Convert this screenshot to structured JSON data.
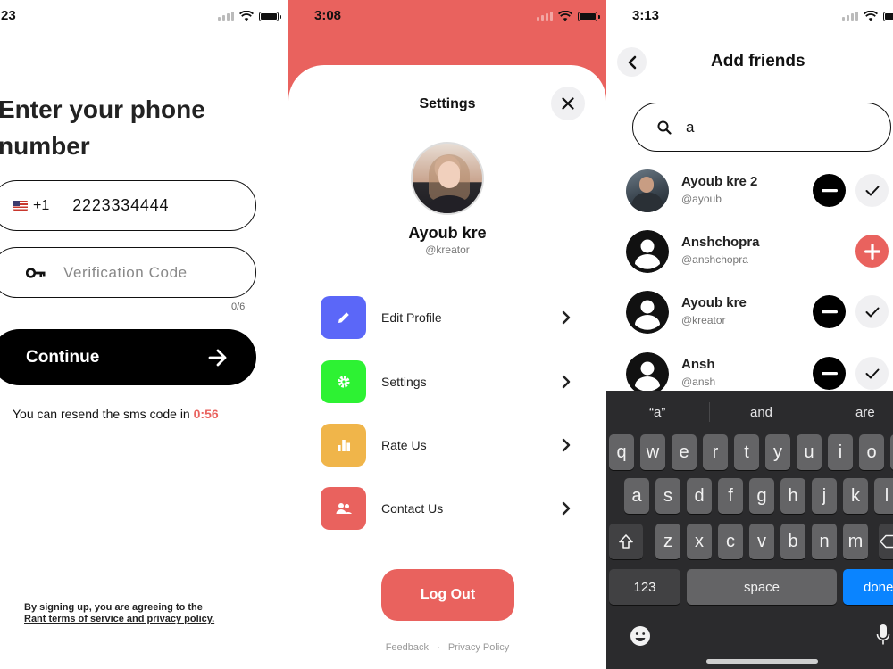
{
  "screen1": {
    "status_time": ":23",
    "headline": "Enter your phone number",
    "country_code": "+1",
    "phone_value": "2223334444",
    "code_placeholder": "Verification Code",
    "code_counter": "0/6",
    "continue_label": "Continue",
    "resend_text": "You can resend the sms code in",
    "resend_timer": "0:56",
    "terms_line1": "By signing up, you are agreeing to the",
    "terms_line2": "Rant terms of service and privacy policy."
  },
  "screen2": {
    "status_time": "3:08",
    "title": "Settings",
    "profile_name": "Ayoub kre",
    "profile_handle": "@kreator",
    "menu": [
      {
        "label": "Edit Profile",
        "color": "#5b67f8",
        "icon": "pencil-icon"
      },
      {
        "label": "Settings",
        "color": "#2df233",
        "icon": "gear-icon"
      },
      {
        "label": "Rate Us",
        "color": "#f0b54a",
        "icon": "bar-chart-icon"
      },
      {
        "label": "Contact Us",
        "color": "#e9625e",
        "icon": "people-icon"
      }
    ],
    "logout_label": "Log Out",
    "footer_feedback": "Feedback",
    "footer_dot": "·",
    "footer_privacy": "Privacy Policy"
  },
  "screen3": {
    "status_time": "3:13",
    "title": "Add friends",
    "search_value": "a",
    "friends": [
      {
        "name": "Ayoub kre 2",
        "handle": "@ayoub",
        "avatar": "photo",
        "actions": [
          "minus",
          "check"
        ]
      },
      {
        "name": "Anshchopra",
        "handle": "@anshchopra",
        "avatar": "default",
        "actions": [
          "plus"
        ]
      },
      {
        "name": "Ayoub kre",
        "handle": "@kreator",
        "avatar": "default",
        "actions": [
          "minus",
          "check"
        ]
      },
      {
        "name": "Ansh",
        "handle": "@ansh",
        "avatar": "default",
        "actions": [
          "minus",
          "check"
        ]
      }
    ],
    "keyboard": {
      "suggestions": [
        "“a”",
        "and",
        "are"
      ],
      "row1": [
        "q",
        "w",
        "e",
        "r",
        "t",
        "y",
        "u",
        "i",
        "o"
      ],
      "row2": [
        "a",
        "s",
        "d",
        "f",
        "g",
        "h",
        "j",
        "k",
        "l"
      ],
      "row3": [
        "z",
        "x",
        "c",
        "v",
        "b",
        "n",
        "m"
      ],
      "numbers_key": "123",
      "space_key": "space",
      "return_key": "done"
    }
  },
  "colors": {
    "accent": "#e9625e",
    "keyboard_bg": "#2b2b2d",
    "done_blue": "#0a84ff"
  }
}
